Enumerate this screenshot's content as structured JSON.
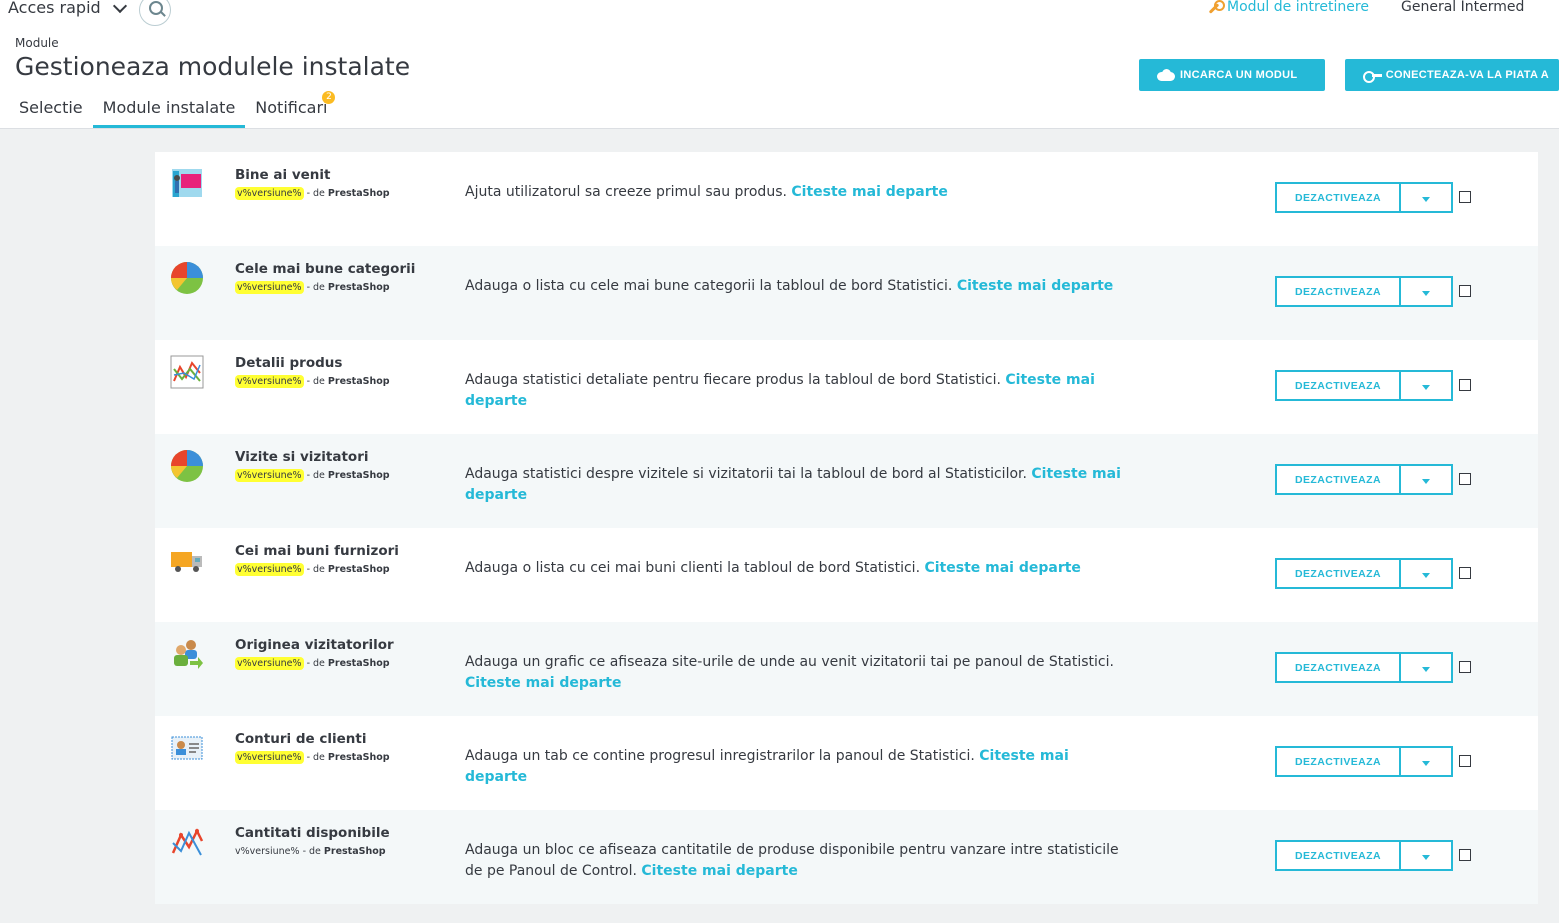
{
  "header": {
    "quick_access": "Acces rapid",
    "maintenance_link": "Modul de intretinere",
    "shop_name": "General Intermed",
    "breadcrumb": "Module",
    "title": "Gestioneaza modulele instalate",
    "upload_button": "INCARCA UN MODUL",
    "connect_button": "CONECTEAZA-VA LA PIATA A"
  },
  "tabs": [
    {
      "label": "Selectie",
      "active": false
    },
    {
      "label": "Module instalate",
      "active": true
    },
    {
      "label": "Notificari",
      "active": false,
      "badge": "2"
    }
  ],
  "colors": {
    "accent": "#25b9d7",
    "highlight": "#ffff33",
    "badge": "#fbbb22"
  },
  "modules": [
    {
      "name": "Bine ai venit",
      "version": "v%versiune%",
      "by": "- de",
      "author": "PrestaShop",
      "highlighted": true,
      "icon": "welcome-board-icon",
      "description": "Ajuta utilizatorul sa creeze primul sau produs.",
      "more": "Citeste mai departe",
      "action": "DEZACTIVEAZA"
    },
    {
      "name": "Cele mai bune categorii",
      "version": "v%versiune%",
      "by": "- de",
      "author": "PrestaShop",
      "highlighted": true,
      "icon": "pie-chart-icon",
      "description": "Adauga o lista cu cele mai bune categorii la tabloul de bord Statistici.",
      "more": "Citeste mai departe",
      "action": "DEZACTIVEAZA"
    },
    {
      "name": "Detalii produs",
      "version": "v%versiune%",
      "by": "- de",
      "author": "PrestaShop",
      "highlighted": true,
      "icon": "line-chart-icon",
      "description": "Adauga statistici detaliate pentru fiecare produs la tabloul de bord Statistici.",
      "more": "Citeste mai departe",
      "action": "DEZACTIVEAZA"
    },
    {
      "name": "Vizite si vizitatori",
      "version": "v%versiune%",
      "by": "- de",
      "author": "PrestaShop",
      "highlighted": true,
      "icon": "pie-chart-icon",
      "description": "Adauga statistici despre vizitele si vizitatorii tai la tabloul de bord al Statisticilor.",
      "more": "Citeste mai departe",
      "action": "DEZACTIVEAZA"
    },
    {
      "name": "Cei mai buni furnizori",
      "version": "v%versiune%",
      "by": "- de",
      "author": "PrestaShop",
      "highlighted": true,
      "icon": "truck-icon",
      "description": "Adauga o lista cu cei mai buni clienti la tabloul de bord Statistici.",
      "more": "Citeste mai departe",
      "action": "DEZACTIVEAZA"
    },
    {
      "name": "Originea vizitatorilor",
      "version": "v%versiune%",
      "by": "- de",
      "author": "PrestaShop",
      "highlighted": true,
      "icon": "users-arrow-icon",
      "description": "Adauga un grafic ce afiseaza site-urile de unde au venit vizitatorii tai pe panoul de Statistici.",
      "more": "Citeste mai departe",
      "action": "DEZACTIVEAZA"
    },
    {
      "name": "Conturi de clienti",
      "version": "v%versiune%",
      "by": "- de",
      "author": "PrestaShop",
      "highlighted": true,
      "icon": "id-card-icon",
      "description": "Adauga un tab ce contine progresul inregistrarilor la panoul de Statistici.",
      "more": "Citeste mai departe",
      "action": "DEZACTIVEAZA"
    },
    {
      "name": "Cantitati disponibile",
      "version": "v%versiune%",
      "by": "- de",
      "author": "PrestaShop",
      "highlighted": false,
      "icon": "zigzag-chart-icon",
      "description": "Adauga un bloc ce afiseaza cantitatile de produse disponibile pentru vanzare intre statisticile de pe Panoul de Control.",
      "more": "Citeste mai departe",
      "action": "DEZACTIVEAZA"
    }
  ]
}
